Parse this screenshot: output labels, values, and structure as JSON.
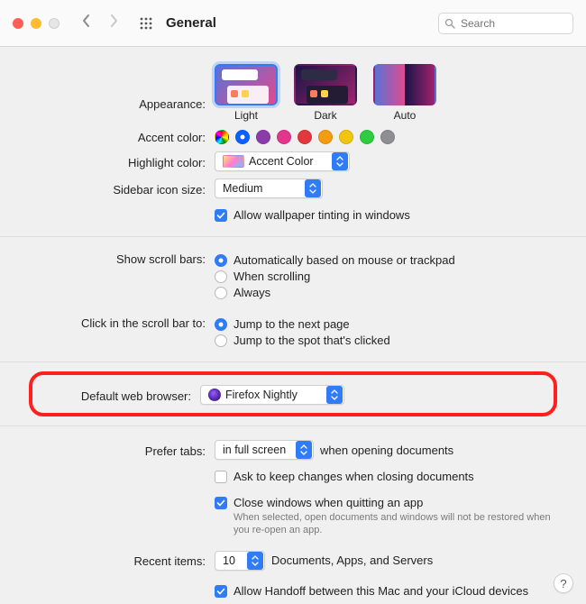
{
  "toolbar": {
    "title": "General",
    "search_placeholder": "Search"
  },
  "appearance": {
    "label": "Appearance:",
    "options": [
      "Light",
      "Dark",
      "Auto"
    ],
    "selected": "Light"
  },
  "accent": {
    "label": "Accent color:",
    "colors": [
      "multicolor",
      "#0a60ff",
      "#8a3ca8",
      "#e0368b",
      "#e0383e",
      "#f39c12",
      "#f1c40f",
      "#2ecc40",
      "#8e8e93"
    ],
    "selected_index": 1
  },
  "highlight": {
    "label": "Highlight color:",
    "value": "Accent Color"
  },
  "sidebar_size": {
    "label": "Sidebar icon size:",
    "value": "Medium"
  },
  "wallpaper_tint": {
    "label": "Allow wallpaper tinting in windows",
    "checked": true
  },
  "scrollbars": {
    "label": "Show scroll bars:",
    "options": [
      "Automatically based on mouse or trackpad",
      "When scrolling",
      "Always"
    ],
    "selected_index": 0
  },
  "scrollclick": {
    "label": "Click in the scroll bar to:",
    "options": [
      "Jump to the next page",
      "Jump to the spot that's clicked"
    ],
    "selected_index": 0
  },
  "browser": {
    "label": "Default web browser:",
    "value": "Firefox Nightly"
  },
  "tabs": {
    "label": "Prefer tabs:",
    "value": "in full screen",
    "trailing": "when opening documents"
  },
  "ask_keep": {
    "label": "Ask to keep changes when closing documents",
    "checked": false
  },
  "close_windows": {
    "label": "Close windows when quitting an app",
    "checked": true,
    "help": "When selected, open documents and windows will not be restored when you re-open an app."
  },
  "recent": {
    "label": "Recent items:",
    "value": "10",
    "trailing": "Documents, Apps, and Servers"
  },
  "handoff": {
    "label": "Allow Handoff between this Mac and your iCloud devices",
    "checked": true
  },
  "help": "?"
}
